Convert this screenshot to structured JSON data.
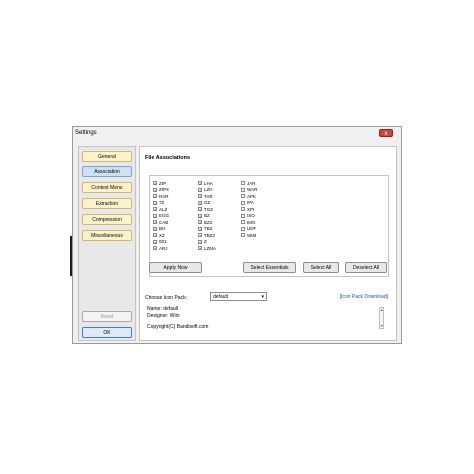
{
  "window": {
    "title": "Settings",
    "close_label": "x"
  },
  "sidebar": {
    "items": [
      {
        "label": "General",
        "active": false
      },
      {
        "label": "Association",
        "active": true
      },
      {
        "label": "Context Menu",
        "active": false
      },
      {
        "label": "Extraction",
        "active": false
      },
      {
        "label": "Compression",
        "active": false
      },
      {
        "label": "Miscellaneous",
        "active": false
      }
    ],
    "reset_label": "Reset",
    "ok_label": "OK"
  },
  "main": {
    "section_title": "File Associations",
    "columns": [
      [
        {
          "ext": "ZIP",
          "checked": true
        },
        {
          "ext": "ZIPX",
          "checked": true
        },
        {
          "ext": "RAR",
          "checked": true
        },
        {
          "ext": "7Z",
          "checked": true
        },
        {
          "ext": "ALZ",
          "checked": true
        },
        {
          "ext": "EGG",
          "checked": true
        },
        {
          "ext": "CAB",
          "checked": true
        },
        {
          "ext": "BH",
          "checked": true
        },
        {
          "ext": "XZ",
          "checked": true
        },
        {
          "ext": "001",
          "checked": true
        },
        {
          "ext": "ARJ",
          "checked": true
        }
      ],
      [
        {
          "ext": "LHA",
          "checked": true
        },
        {
          "ext": "LZH",
          "checked": true
        },
        {
          "ext": "TAR",
          "checked": true
        },
        {
          "ext": "GZ",
          "checked": true
        },
        {
          "ext": "TGZ",
          "checked": true
        },
        {
          "ext": "BZ",
          "checked": true
        },
        {
          "ext": "BZ2",
          "checked": true
        },
        {
          "ext": "TBZ",
          "checked": true
        },
        {
          "ext": "TBZ2",
          "checked": true
        },
        {
          "ext": "Z",
          "checked": true
        },
        {
          "ext": "LZMA",
          "checked": true
        }
      ],
      [
        {
          "ext": "JAR",
          "checked": false
        },
        {
          "ext": "WAR",
          "checked": false
        },
        {
          "ext": "APK",
          "checked": false
        },
        {
          "ext": "IPA",
          "checked": false
        },
        {
          "ext": "XPI",
          "checked": false
        },
        {
          "ext": "ISO",
          "checked": false
        },
        {
          "ext": "IMG",
          "checked": false
        },
        {
          "ext": "UDF",
          "checked": false
        },
        {
          "ext": "WIM",
          "checked": false
        }
      ]
    ],
    "buttons": {
      "apply_now": "Apply Now",
      "select_essentials": "Select Essentials",
      "select_all": "Select All",
      "deselect_all": "Deselect All"
    },
    "icon_pack": {
      "label": "Choose Icon Pack:",
      "selected": "default",
      "download_link": "[Icon Pack Download]",
      "name_line": "Name: default",
      "designer_line": "Designer: Wiin",
      "copyright_line": "Copyright(C) Bandisoft.com"
    }
  },
  "colors": {
    "active_item": "#cfe0f2",
    "item_bg": "#fdf2c9",
    "link": "#1a4e9a",
    "close": "#c9483d"
  }
}
